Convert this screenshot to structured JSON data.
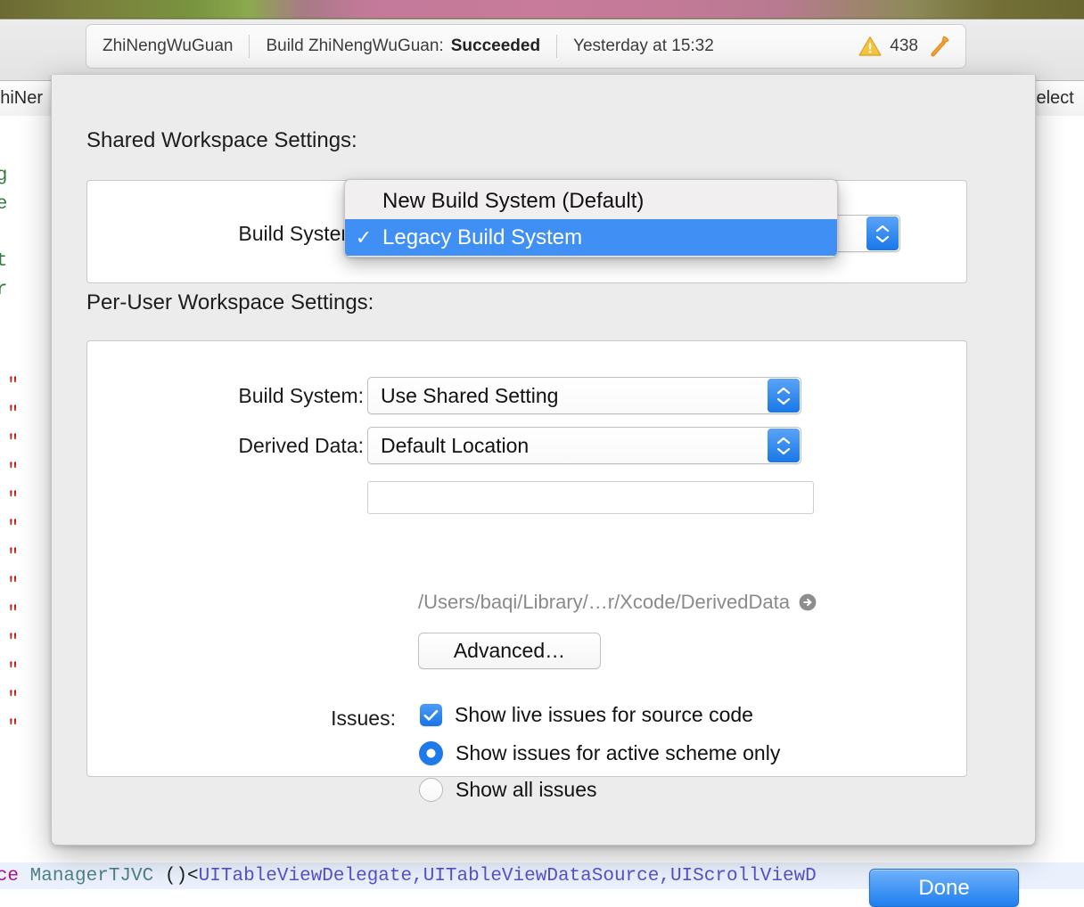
{
  "window": {
    "toolbar": {
      "activity": {
        "scheme": "ZhiNengWuGuan",
        "build_status_prefix": "Build ZhiNengWuGuan:",
        "build_status": "Succeeded",
        "timestamp": "Yesterday at 15:32",
        "warning_icon": "warning-triangle-icon",
        "warning_count": "438",
        "hammer_icon": "hammer-icon"
      }
    },
    "jump_bar": {
      "left_text": "ZhiNer",
      "right_text": "No Select"
    },
    "editor_code": [
      {
        "text": "anag",
        "style": "comment"
      },
      {
        "text": "hiNe",
        "style": "comment"
      },
      {
        "text": "reat",
        "style": "comment"
      },
      {
        "text": "opyr",
        "style": "comment"
      },
      {
        "text": "rt  \"",
        "style": "import"
      },
      {
        "text": "rt  \"",
        "style": "import"
      },
      {
        "text": "rt  \"",
        "style": "import"
      },
      {
        "text": "rt  \"",
        "style": "import"
      },
      {
        "text": "rt  \"",
        "style": "import"
      },
      {
        "text": "rt  \"",
        "style": "import"
      },
      {
        "text": "rt  \"",
        "style": "import"
      },
      {
        "text": "rt  \"",
        "style": "import"
      },
      {
        "text": "rt  \"",
        "style": "import"
      },
      {
        "text": "rt  \"",
        "style": "import"
      },
      {
        "text": "rt  \"",
        "style": "import"
      },
      {
        "text": "rt  \"",
        "style": "import"
      },
      {
        "text": "rt  \"",
        "style": "import"
      }
    ],
    "bottom_code": {
      "keyword": "rface",
      "class_name": " ManagerTJVC",
      "plain": " ()<",
      "protocols": "UITableViewDelegate,UITableViewDataSource,UIScrollViewD"
    }
  },
  "sheet": {
    "shared_section": {
      "title": "Shared Workspace Settings:",
      "build_system_label": "Build System:",
      "build_system_value": "Legacy Build System"
    },
    "peruser_section": {
      "title": "Per-User Workspace Settings:",
      "build_system_label": "Build System:",
      "build_system_value": "Use Shared Setting",
      "derived_data_label": "Derived Data:",
      "derived_data_value": "Default Location",
      "custom_path_value": "",
      "custom_path_placeholder": "",
      "resolved_path": "/Users/baqi/Library/…r/Xcode/DerivedData",
      "reveal_icon": "arrow-in-circle-icon",
      "advanced_button": "Advanced…",
      "issues_label": "Issues:",
      "issues": [
        {
          "type": "checkbox",
          "label": "Show live issues for source code",
          "checked": true
        },
        {
          "type": "radio",
          "label": "Show issues for active scheme only",
          "checked": true
        },
        {
          "type": "radio",
          "label": "Show all issues",
          "checked": false
        }
      ]
    },
    "done_button": "Done"
  },
  "dropdown_menu": {
    "items": [
      {
        "label": "New Build System (Default)",
        "checked": false,
        "selected": false
      },
      {
        "label": "Legacy Build System",
        "checked": true,
        "selected": true
      }
    ],
    "checkmark": "✓",
    "highlight_color": "#3f8ff5"
  },
  "colors": {
    "accent_blue": "#1f7fef",
    "menu_highlight": "#3f8ff5",
    "sheet_bg": "#ececec",
    "warning_yellow": "#f5c242",
    "hammer_orange": "#f08a1e"
  }
}
